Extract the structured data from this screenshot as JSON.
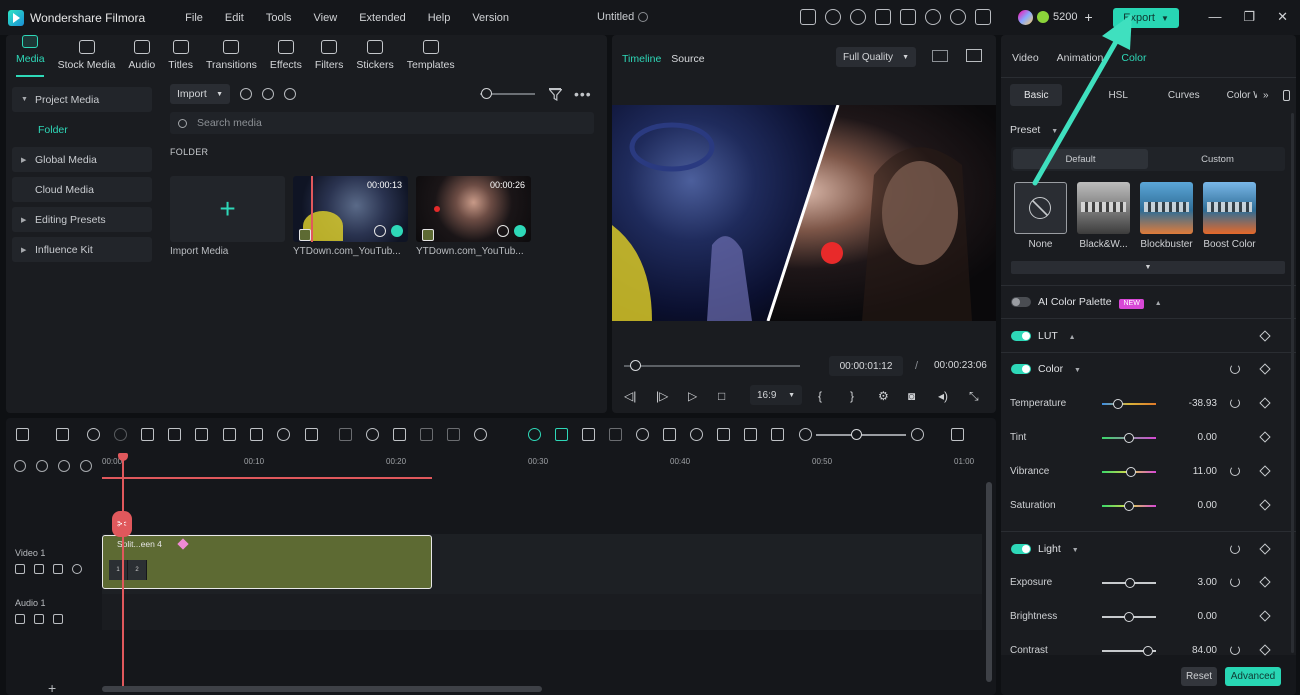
{
  "app": {
    "name": "Wondershare Filmora",
    "menu": [
      "File",
      "Edit",
      "Tools",
      "View",
      "Extended",
      "Help",
      "Version"
    ],
    "doc_title": "Untitled",
    "credits": "5200",
    "export_label": "Export"
  },
  "media": {
    "tabs": [
      "Media",
      "Stock Media",
      "Audio",
      "Titles",
      "Transitions",
      "Effects",
      "Filters",
      "Stickers",
      "Templates"
    ],
    "sidebar": [
      "Project Media",
      "Folder",
      "Global Media",
      "Cloud Media",
      "Editing Presets",
      "Influence Kit"
    ],
    "import_label": "Import",
    "search_placeholder": "Search media",
    "folder_heading": "FOLDER",
    "import_card_label": "Import Media",
    "clips": [
      {
        "duration": "00:00:13",
        "name": "YTDown.com_YouTub..."
      },
      {
        "duration": "00:00:26",
        "name": "YTDown.com_YouTub..."
      }
    ]
  },
  "preview": {
    "tabs": [
      "Timeline",
      "Source"
    ],
    "quality": "Full Quality",
    "current_time": "00:00:01:12",
    "separator": "/",
    "total_time": "00:00:23:06",
    "ratio": "16:9",
    "progress": 0.06
  },
  "color": {
    "tabs": [
      "Video",
      "Animation",
      "Color"
    ],
    "sub_tabs": [
      "Basic",
      "HSL",
      "Curves",
      "Color Whe"
    ],
    "preset_label": "Preset",
    "preset_tabs": [
      "Default",
      "Custom"
    ],
    "presets": [
      "None",
      "Black&W...",
      "Blockbuster",
      "Boost Color"
    ],
    "ai_palette": "AI Color Palette",
    "new_badge": "NEW",
    "lut": "LUT",
    "color_section": "Color",
    "light_section": "Light",
    "params": [
      {
        "name": "Temperature",
        "value": "-38.93",
        "pos": 0.3,
        "gradient": "linear-gradient(90deg,#3a8ee6,#d8b43a,#e07a2a)"
      },
      {
        "name": "Tint",
        "value": "0.00",
        "pos": 0.5,
        "gradient": "linear-gradient(90deg,#3ad86a,#d848d6)"
      },
      {
        "name": "Vibrance",
        "value": "11.00",
        "pos": 0.54,
        "gradient": "linear-gradient(90deg,#3ad86a,#d8d84a,#d848d6)"
      },
      {
        "name": "Saturation",
        "value": "0.00",
        "pos": 0.5,
        "gradient": "linear-gradient(90deg,#3ad86a,#d8d84a,#d848d6)"
      }
    ],
    "light_params": [
      {
        "name": "Exposure",
        "value": "3.00",
        "pos": 0.51
      },
      {
        "name": "Brightness",
        "value": "0.00",
        "pos": 0.5
      },
      {
        "name": "Contrast",
        "value": "84.00",
        "pos": 0.86
      }
    ],
    "reset_label": "Reset",
    "advanced_label": "Advanced"
  },
  "timeline": {
    "ruler": [
      "00:00",
      "00:10",
      "00:20",
      "00:30",
      "00:40",
      "00:50",
      "01:00"
    ],
    "tracks": [
      {
        "name": "Video 1"
      },
      {
        "name": "Audio 1"
      }
    ],
    "clip_label": "Split...een 4",
    "clip_thumbs": [
      "1",
      "2"
    ]
  },
  "colors": {
    "accent": "#2ed8b8",
    "playhead": "#e0585c",
    "clip": "#5d6a33"
  }
}
